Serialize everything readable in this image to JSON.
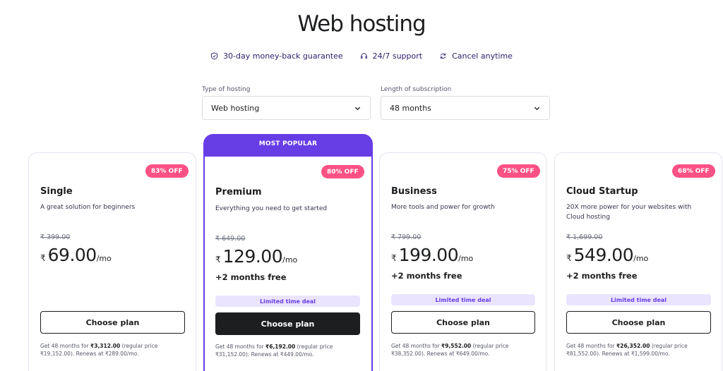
{
  "page": {
    "title": "Web hosting"
  },
  "features": [
    {
      "icon": "shield-icon",
      "label": "30-day money-back guarantee"
    },
    {
      "icon": "headset-icon",
      "label": "24/7 support"
    },
    {
      "icon": "cycle-icon",
      "label": "Cancel anytime"
    }
  ],
  "filters": {
    "hosting_type": {
      "label": "Type of hosting",
      "value": "Web hosting"
    },
    "subscription": {
      "label": "Length of subscription",
      "value": "48 months"
    }
  },
  "popular_label": "MOST POPULAR",
  "plans": [
    {
      "discount": "83% OFF",
      "name": "Single",
      "desc": "A great solution for beginners",
      "old_price": "₹ 399.00",
      "currency": "₹",
      "price": "69.00",
      "per": "/mo",
      "bonus": "",
      "deal": "",
      "cta": "Choose plan",
      "renew_pre": "Get 48 months for ",
      "renew_total": "₹3,312.00",
      "renew_post": " (regular price ₹19,152.00). Renews at ₹289.00/mo."
    },
    {
      "discount": "80% OFF",
      "name": "Premium",
      "desc": "Everything you need to get started",
      "old_price": "₹ 649.00",
      "currency": "₹",
      "price": "129.00",
      "per": "/mo",
      "bonus": "+2 months free",
      "deal": "Limited time deal",
      "cta": "Choose plan",
      "renew_pre": "Get 48 months for ",
      "renew_total": "₹6,192.00",
      "renew_post": " (regular price ₹31,152.00). Renews at ₹449.00/mo."
    },
    {
      "discount": "75% OFF",
      "name": "Business",
      "desc": "More tools and power for growth",
      "old_price": "₹ 799.00",
      "currency": "₹",
      "price": "199.00",
      "per": "/mo",
      "bonus": "+2 months free",
      "deal": "Limited time deal",
      "cta": "Choose plan",
      "renew_pre": "Get 48 months for ",
      "renew_total": "₹9,552.00",
      "renew_post": " (regular price ₹38,352.00). Renews at ₹649.00/mo."
    },
    {
      "discount": "68% OFF",
      "name": "Cloud Startup",
      "desc": "20X more power for your websites with Cloud hosting",
      "old_price": "₹ 1,699.00",
      "currency": "₹",
      "price": "549.00",
      "per": "/mo",
      "bonus": "+2 months free",
      "deal": "Limited time deal",
      "cta": "Choose plan",
      "renew_pre": "Get 48 months for ",
      "renew_total": "₹26,352.00",
      "renew_post": " (regular price ₹81,552.00). Renews at ₹1,599.00/mo."
    }
  ],
  "colors": {
    "accent": "#673de6",
    "badge": "#fc5185",
    "deal_bg": "#ebe4ff",
    "dark_button": "#1d1e20"
  }
}
